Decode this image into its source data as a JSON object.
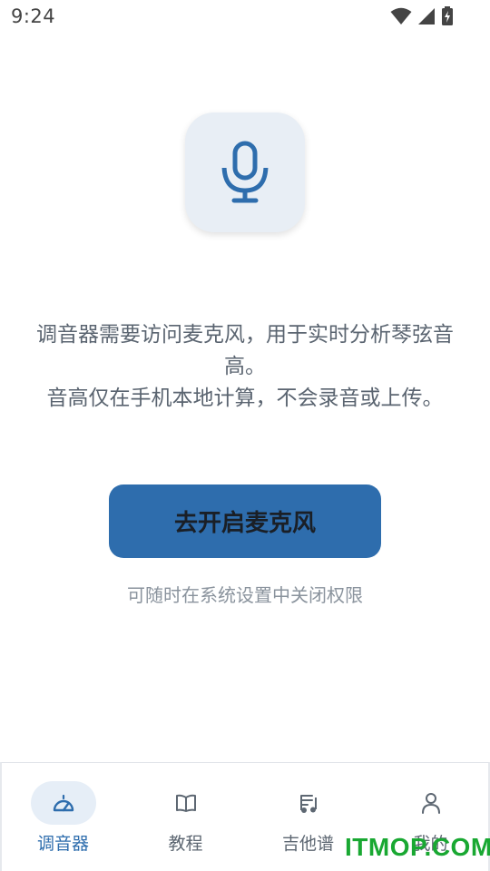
{
  "status_bar": {
    "time": "9:24",
    "icons": [
      "wifi-icon",
      "cell-signal-icon",
      "battery-charging-icon"
    ]
  },
  "mic_tile": {
    "icon": "microphone-icon"
  },
  "message": {
    "line1": "调音器需要访问麦克风，用于实时分析琴弦音高。",
    "line2": "音高仅在手机本地计算，不会录音或上传。"
  },
  "cta": {
    "label": "去开启麦克风"
  },
  "hint": "可随时在系统设置中关闭权限",
  "bottom_nav": {
    "items": [
      {
        "label": "调音器",
        "icon": "tuner-gauge-icon",
        "active": true
      },
      {
        "label": "教程",
        "icon": "book-icon",
        "active": false
      },
      {
        "label": "吉他谱",
        "icon": "music-sheet-icon",
        "active": false
      },
      {
        "label": "我的",
        "icon": "person-icon",
        "active": false
      }
    ]
  },
  "watermark": "ITMOP.COM",
  "colors": {
    "accent": "#2e6dad",
    "tile_bg": "#e8eef5",
    "text_secondary": "#5a6470",
    "watermark": "#19a832"
  }
}
